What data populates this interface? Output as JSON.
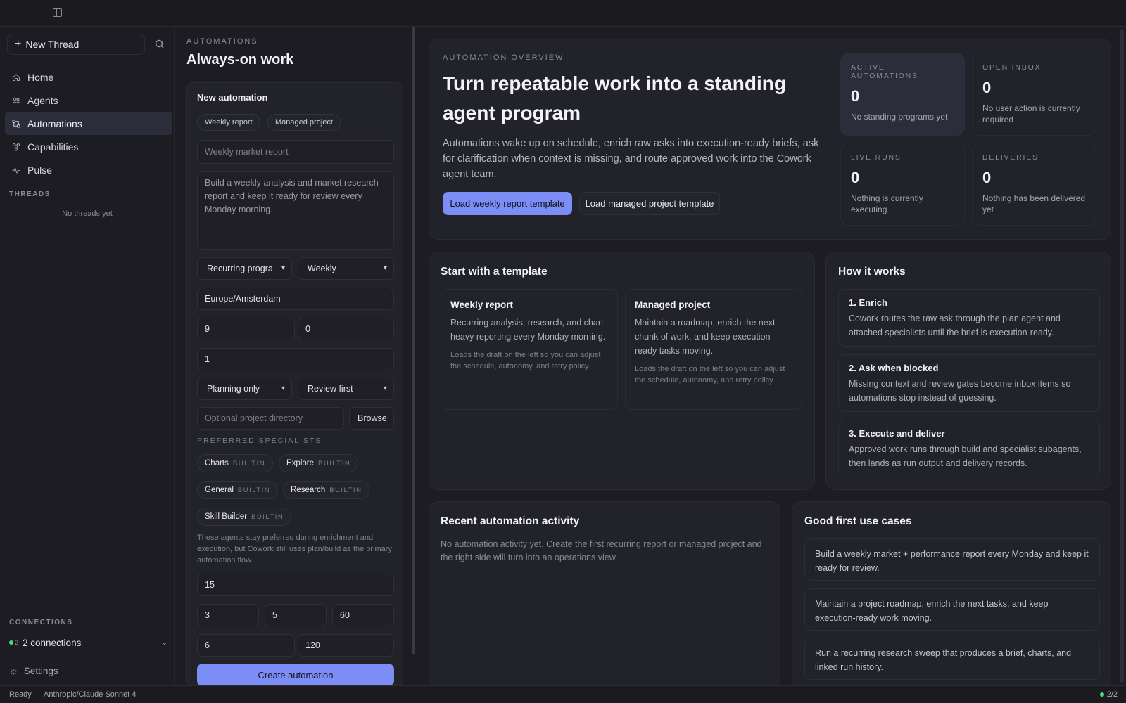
{
  "sidebar": {
    "new_thread": "New Thread",
    "nav": [
      {
        "label": "Home",
        "icon": "home-icon"
      },
      {
        "label": "Agents",
        "icon": "users-icon"
      },
      {
        "label": "Automations",
        "icon": "automations-icon",
        "active": true
      },
      {
        "label": "Capabilities",
        "icon": "capabilities-icon"
      },
      {
        "label": "Pulse",
        "icon": "pulse-icon"
      }
    ],
    "threads_label": "THREADS",
    "no_threads": "No threads yet",
    "connections_label": "CONNECTIONS",
    "connections_count": "2",
    "connections_text": "2 connections",
    "settings": "Settings"
  },
  "automations": {
    "breadcrumb": "AUTOMATIONS",
    "title": "Always-on work",
    "form": {
      "title": "New automation",
      "template_chips": [
        "Weekly report",
        "Managed project"
      ],
      "name_placeholder": "Weekly market report",
      "description_placeholder": "Build a weekly analysis and market research report and keep it ready for review every Monday morning.",
      "program_type": "Recurring progra",
      "frequency": "Weekly",
      "timezone": "Europe/Amsterdam",
      "hour": "9",
      "minute": "0",
      "day": "1",
      "autonomy": "Planning only",
      "review": "Review first",
      "directory_placeholder": "Optional project directory",
      "browse": "Browse",
      "specialists_label": "PREFERRED SPECIALISTS",
      "specialists": [
        {
          "name": "Charts",
          "tag": "BUILTIN"
        },
        {
          "name": "Explore",
          "tag": "BUILTIN"
        },
        {
          "name": "General",
          "tag": "BUILTIN"
        },
        {
          "name": "Research",
          "tag": "BUILTIN"
        },
        {
          "name": "Skill Builder",
          "tag": "BUILTIN"
        }
      ],
      "specialists_hint": "These agents stay preferred during enrichment and execution, but Cowork still uses plan/build as the primary automation flow.",
      "value_a": "15",
      "value_b": "3",
      "value_c": "5",
      "value_d": "60",
      "value_e": "6",
      "value_f": "120",
      "create": "Create automation"
    }
  },
  "overview": {
    "label": "AUTOMATION OVERVIEW",
    "title": "Turn repeatable work into a standing agent program",
    "description": "Automations wake up on schedule, enrich raw asks into execution-ready briefs, ask for clarification when context is missing, and route approved work into the Cowork agent team.",
    "btn_weekly": "Load weekly report template",
    "btn_managed": "Load managed project template",
    "stats": [
      {
        "label": "ACTIVE AUTOMATIONS",
        "value": "0",
        "desc": "No standing programs yet"
      },
      {
        "label": "OPEN INBOX",
        "value": "0",
        "desc": "No user action is currently required"
      },
      {
        "label": "LIVE RUNS",
        "value": "0",
        "desc": "Nothing is currently executing"
      },
      {
        "label": "DELIVERIES",
        "value": "0",
        "desc": "Nothing has been delivered yet"
      }
    ]
  },
  "templates": {
    "title": "Start with a template",
    "cards": [
      {
        "title": "Weekly report",
        "desc": "Recurring analysis, research, and chart-heavy reporting every Monday morning.",
        "note": "Loads the draft on the left so you can adjust the schedule, autonomy, and retry policy."
      },
      {
        "title": "Managed project",
        "desc": "Maintain a roadmap, enrich the next chunk of work, and keep execution-ready tasks moving.",
        "note": "Loads the draft on the left so you can adjust the schedule, autonomy, and retry policy."
      }
    ]
  },
  "how": {
    "title": "How it works",
    "steps": [
      {
        "title": "1. Enrich",
        "desc": "Cowork routes the raw ask through the plan agent and attached specialists until the brief is execution-ready."
      },
      {
        "title": "2. Ask when blocked",
        "desc": "Missing context and review gates become inbox items so automations stop instead of guessing."
      },
      {
        "title": "3. Execute and deliver",
        "desc": "Approved work runs through build and specialist subagents, then lands as run output and delivery records."
      }
    ]
  },
  "activity": {
    "title": "Recent automation activity",
    "empty": "No automation activity yet. Create the first recurring report or managed project and the right side will turn into an operations view."
  },
  "usecases": {
    "title": "Good first use cases",
    "items": [
      "Build a weekly market + performance report every Monday and keep it ready for review.",
      "Maintain a project roadmap, enrich the next tasks, and keep execution-ready work moving.",
      "Run a recurring research sweep that produces a brief, charts, and linked run history."
    ]
  },
  "status": {
    "state": "Ready",
    "model": "Anthropic/Claude Sonnet 4",
    "pages": "2/2"
  },
  "colors": {
    "accent": "#7c8ef5",
    "background": "#1c1c22",
    "panel": "#22232a",
    "active_nav": "#2b2d3b",
    "online": "#4ade80"
  }
}
